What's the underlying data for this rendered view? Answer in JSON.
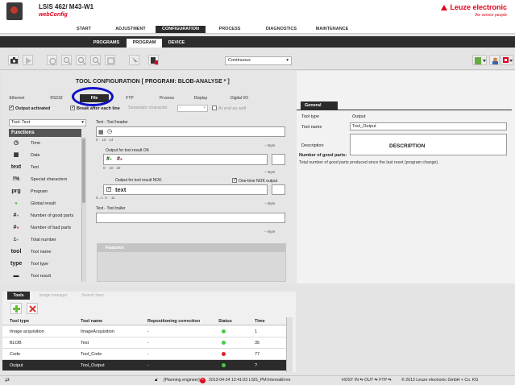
{
  "header": {
    "device": "LSIS 462/ M43-W1",
    "app": "webConfig",
    "brand": "Leuze electronic",
    "tagline": "the sensor people"
  },
  "main_nav": [
    {
      "label": "START",
      "active": false
    },
    {
      "label": "ADJUSTMENT",
      "active": false
    },
    {
      "label": "CONFIGURATION",
      "active": true
    },
    {
      "label": "PROCESS",
      "active": false
    },
    {
      "label": "DIAGNOSTICS",
      "active": false
    },
    {
      "label": "MAINTENANCE",
      "active": false
    }
  ],
  "sub_nav": [
    {
      "label": "PROGRAMS",
      "active": false
    },
    {
      "label": "PROGRAM",
      "active": true
    },
    {
      "label": "DEVICE",
      "active": false
    }
  ],
  "toolbar": {
    "mode": "Continuous"
  },
  "tool_config": {
    "title": "TOOL CONFIGURATION   [ PROGRAM: BLOB-ANALYSE * ]",
    "tabs": [
      "Ethernet",
      "RS232",
      "File",
      "FTP",
      "Process",
      "Display",
      "Digital I/O"
    ],
    "active_tab": "File",
    "output_activated": "Output activated",
    "break_after_line": "Break after each line",
    "separator_label": "Separator character",
    "separator_value": "/",
    "at_end": "At end as well",
    "tool_select": "Tool: Text",
    "functions_header": "Functions",
    "functions": [
      {
        "icon": "time-icon",
        "glyph": "◷",
        "label": "Time"
      },
      {
        "icon": "date-icon",
        "glyph": "▦",
        "label": "Date"
      },
      {
        "icon": "text-icon",
        "glyph": "text",
        "label": "Text"
      },
      {
        "icon": "special-chars-icon",
        "glyph": "!%",
        "label": "Special characters"
      },
      {
        "icon": "program-icon",
        "glyph": "prg",
        "label": "Program"
      },
      {
        "icon": "global-result-icon",
        "glyph": "●",
        "label": "Global result"
      },
      {
        "icon": "good-parts-icon",
        "glyph": "#●",
        "label": "Number of good parts"
      },
      {
        "icon": "bad-parts-icon",
        "glyph": "#●",
        "label": "Number of bad parts"
      },
      {
        "icon": "total-number-icon",
        "glyph": "Σ●",
        "label": "Total number"
      },
      {
        "icon": "tool-name-icon",
        "glyph": "tool",
        "label": "Tool name"
      },
      {
        "icon": "tool-type-icon",
        "glyph": "type",
        "label": "Tool type"
      },
      {
        "icon": "tool-result-icon",
        "glyph": "▬",
        "label": "Tool result"
      }
    ],
    "header_label": "Text - Tool header",
    "header_scale": [
      "0",
      "10",
      "14"
    ],
    "ok_label": "Output for tool result OK",
    "ok_scale": [
      "0",
      "10",
      "20"
    ],
    "nok_label": "Output for tool result NOK",
    "nok_scale": [
      "0...n",
      "0",
      "11"
    ],
    "one_time_nok": "One-time NOK output",
    "nok_text": "text",
    "trailer_label": "Text - Tool trailer",
    "byte": "-- Byte",
    "features": "Features"
  },
  "general": {
    "tab": "General",
    "tool_type_label": "Tool type",
    "tool_type_value": "Output",
    "tool_name_label": "Tool name",
    "tool_name_value": "Tool_Output",
    "description_label": "Description",
    "desc_title": "DESCRIPTION",
    "desc_sub": "Number of good parts:",
    "desc_text": "Total number of good parts produced since the last reset (program change)."
  },
  "tools": {
    "tabs": [
      "Tools",
      "Image manager",
      "Search lines"
    ],
    "columns": [
      "Tool type",
      "Tool name",
      "Repositioning correction",
      "Status",
      "Time"
    ],
    "rows": [
      {
        "type": "Image acquisition",
        "name": "ImageAcquisition",
        "repos": "-",
        "status": "#44cc44",
        "time": "1",
        "selected": false
      },
      {
        "type": "BLOB",
        "name": "Test",
        "repos": "-",
        "status": "#44cc44",
        "time": "35",
        "selected": false
      },
      {
        "type": "Code",
        "name": "Tool_Code",
        "repos": "-",
        "status": "#dd2222",
        "time": "77",
        "selected": false
      },
      {
        "type": "Output",
        "name": "Tool_Output",
        "repos": "-",
        "status": "#44cc44",
        "time": "?",
        "selected": true
      }
    ]
  },
  "status_bar": {
    "user": "[Planning engineer]",
    "message": "2013-04-24 12:41:03 LSIS_PM:InternalError",
    "host": "HOST IN ⇆  OUT ⇆  FTP ⇆",
    "copyright": "© 2013 Leuze electronic GmbH + Co. KG"
  },
  "colors": {
    "accent": "#e2001a",
    "dark": "#2b2b2b",
    "highlight_circle": "#1010c8"
  }
}
